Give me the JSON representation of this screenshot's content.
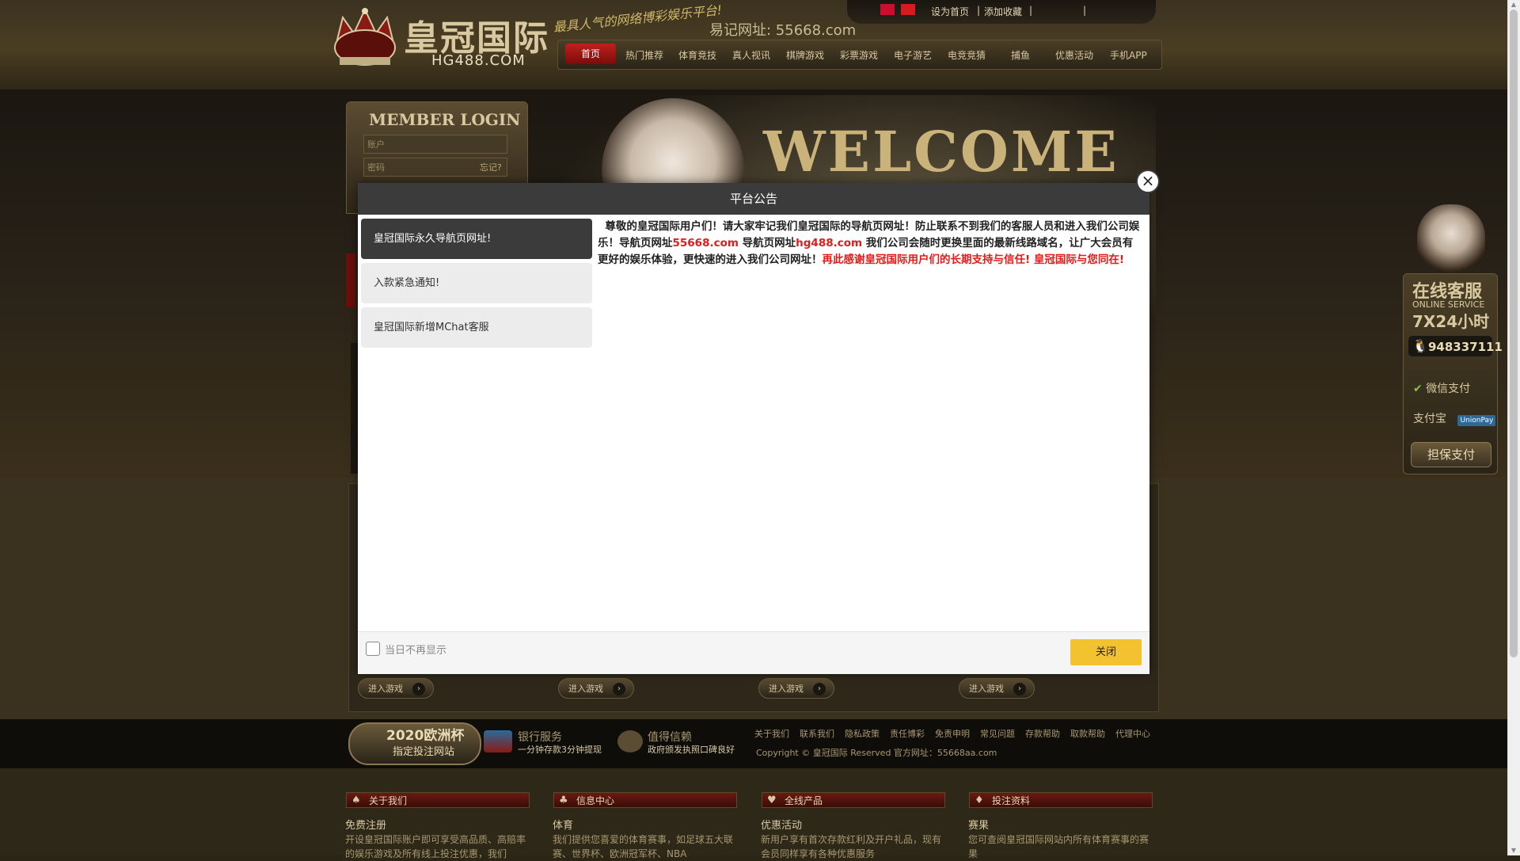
{
  "header": {
    "brand_name": "皇冠国际",
    "logo_domain": "HG488.COM",
    "slogan": "最具人气的网络博彩娱乐平台!",
    "easy_url": "易记网址: 55668.com",
    "top_links": {
      "set_home": "设为首页",
      "add_fav": "添加收藏",
      "sep1": "|",
      "sep2": "|",
      "sep3": "|"
    }
  },
  "nav": {
    "items": [
      {
        "label": "首页"
      },
      {
        "label": "热门推荐"
      },
      {
        "label": "体育竞技"
      },
      {
        "label": "真人视讯"
      },
      {
        "label": "棋牌游戏"
      },
      {
        "label": "彩票游戏"
      },
      {
        "label": "电子游艺"
      },
      {
        "label": "电竞竞猜"
      },
      {
        "label": "捕鱼"
      },
      {
        "label": "优惠活动"
      },
      {
        "label": "手机APP"
      }
    ]
  },
  "hero": {
    "welcome_text": "WELCOME"
  },
  "login": {
    "title": "MEMBER LOGIN",
    "username_placeholder": "账户",
    "password_placeholder": "密码",
    "forgot": "忘记?"
  },
  "modal": {
    "title": "平台公告",
    "tabs": [
      {
        "label": "皇冠国际永久导航页网址!",
        "active": true
      },
      {
        "label": "入款紧急通知!",
        "active": false
      },
      {
        "label": "皇冠国际新增MChat客服",
        "active": false
      }
    ],
    "body": {
      "part1": "尊敬的皇冠国际用户们！请大家牢记我们皇冠国际的导航页网址！防止联系不到我们的客服人员和进入我们公司娱乐！导航页网址",
      "link1": "55668.com",
      "part2": " 导航页网址",
      "link2": "hg488.com",
      "part3": " 我们公司会随时更换里面的最新线路域名，让广大会员有更好的娱乐体验，更快速的进入我们公司网址！",
      "thanks": "再此感谢皇冠国际用户们的长期支持与信任! 皇冠国际与您同在!"
    },
    "checkbox_label": "当日不再显示",
    "close_button": "关闭",
    "close_x": "×"
  },
  "games": {
    "enter_label": "进入游戏",
    "arrow": "›"
  },
  "footer": {
    "euro_title": "2020欧洲杯",
    "euro_sub": "指定投注网站",
    "services": [
      {
        "title": "银行服务",
        "sub": "一分钟存款3分钟提现"
      },
      {
        "title": "值得信赖",
        "sub": "政府颁发执照口碑良好"
      }
    ],
    "links": [
      "关于我们",
      "联系我们",
      "隐私政策",
      "责任博彩",
      "免责申明",
      "常见问题",
      "存款帮助",
      "取款帮助",
      "代理中心"
    ],
    "copyright": "Copyright © 皇冠国际 Reserved    官方网址：55668aa.com",
    "columns": [
      {
        "head": "关于我们",
        "suit": "♠",
        "title": "免费注册",
        "text": "开设皇冠国际账户即可享受高品质、高赔率的娱乐游戏及所有线上投注优惠，我们"
      },
      {
        "head": "信息中心",
        "suit": "♣",
        "title": "体育",
        "text": "我们提供您喜爱的体育赛事，如足球五大联赛、世界杯、欧洲冠军杯、NBA"
      },
      {
        "head": "全线产品",
        "suit": "♥",
        "title": "优惠活动",
        "text": "新用户享有首次存款红利及开户礼品，现有会员同样享有各种优惠服务"
      },
      {
        "head": "投注资料",
        "suit": "♦",
        "title": "赛果",
        "text": "您可查阅皇冠国际网站内所有体育赛事的赛果"
      }
    ]
  },
  "service_widget": {
    "title": "在线客服",
    "subtitle": "ONLINE SERVICE",
    "hours": "7X24小时",
    "qq": "948337111",
    "wechat_pay": "微信支付",
    "alipay": "支付宝",
    "unionpay": "UnionPay",
    "guarantee_button": "担保支付"
  },
  "colors": {
    "modal_header": "#3b3b3b",
    "close_button": "#f2c230",
    "link_red": "#e31b1b"
  }
}
